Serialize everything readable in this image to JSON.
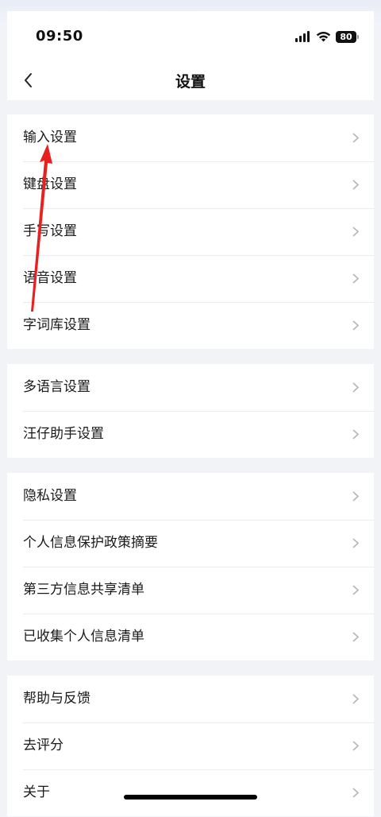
{
  "status_bar": {
    "time": "09:50",
    "battery": "80"
  },
  "nav": {
    "title": "设置"
  },
  "sections": [
    {
      "items": [
        "输入设置",
        "键盘设置",
        "手写设置",
        "语音设置",
        "字词库设置"
      ]
    },
    {
      "items": [
        "多语言设置",
        "汪仔助手设置"
      ]
    },
    {
      "items": [
        "隐私设置",
        "个人信息保护政策摘要",
        "第三方信息共享清单",
        "已收集个人信息清单"
      ]
    },
    {
      "items": [
        "帮助与反馈",
        "去评分",
        "关于"
      ]
    }
  ],
  "colors": {
    "annotation_arrow": "#e8201f",
    "row_text": "#1a1a1a",
    "chevron": "#b5b5b5",
    "page_background": "#f2f3f6"
  },
  "icons": {
    "back": "chevron-left-icon",
    "row": "chevron-right-icon",
    "wifi": "wifi-icon",
    "signal": "signal-icon",
    "battery": "battery-icon"
  }
}
